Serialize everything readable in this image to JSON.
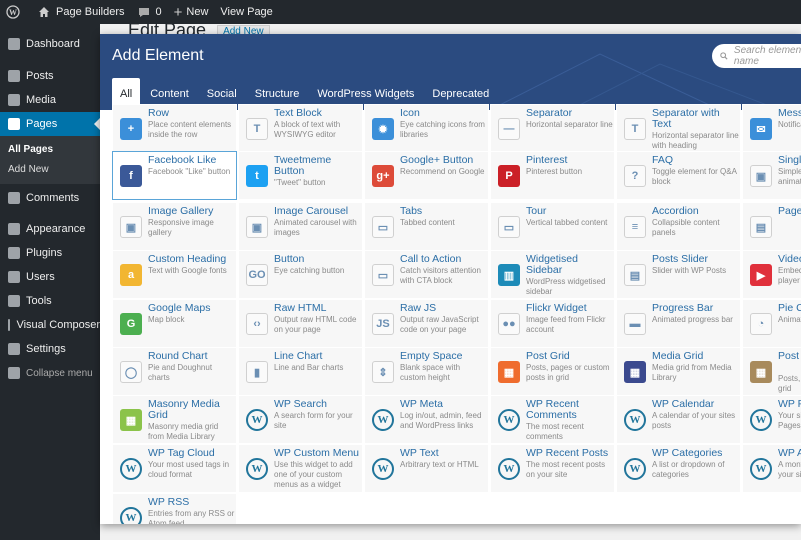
{
  "adminbar": {
    "site": "Page Builders",
    "comments": "0",
    "new": "New",
    "view": "View Page"
  },
  "sidebar": {
    "items": [
      {
        "label": "Dashboard",
        "icon": "dashboard-icon"
      },
      {
        "label": "Posts",
        "icon": "pin-icon"
      },
      {
        "label": "Media",
        "icon": "media-icon"
      },
      {
        "label": "Pages",
        "icon": "pages-icon",
        "active": true
      },
      {
        "label": "Comments",
        "icon": "comment-icon"
      },
      {
        "label": "Appearance",
        "icon": "brush-icon"
      },
      {
        "label": "Plugins",
        "icon": "plugin-icon"
      },
      {
        "label": "Users",
        "icon": "users-icon"
      },
      {
        "label": "Tools",
        "icon": "wrench-icon"
      },
      {
        "label": "Visual Composer",
        "icon": "vc-icon"
      },
      {
        "label": "Settings",
        "icon": "settings-icon"
      },
      {
        "label": "Collapse menu",
        "icon": "collapse-icon"
      }
    ],
    "submenu": [
      "All Pages",
      "Add New"
    ]
  },
  "page": {
    "title": "Edit Page",
    "add_new": "Add New"
  },
  "modal": {
    "title": "Add Element",
    "search_placeholder": "Search element by name",
    "tabs": [
      "All",
      "Content",
      "Social",
      "Structure",
      "WordPress Widgets",
      "Deprecated"
    ]
  },
  "colors": {
    "modal_header": "#2b4b80",
    "admin_dark": "#23282d",
    "active_blue": "#0073aa",
    "title_blue": "#2b6ea6"
  },
  "elements": [
    {
      "title": "Row",
      "desc": "Place content elements inside the row",
      "icon": "row-icon",
      "color": "#3b8fd9"
    },
    {
      "title": "Text Block",
      "desc": "A block of text with WYSIWYG editor",
      "icon": "text-block-icon",
      "color": "#e4e4e4"
    },
    {
      "title": "Icon",
      "desc": "Eye catching icons from libraries",
      "icon": "sun-icon",
      "color": "#3b8fd9"
    },
    {
      "title": "Separator",
      "desc": "Horizontal separator line",
      "icon": "separator-icon",
      "color": "#e4e4e4"
    },
    {
      "title": "Separator with Text",
      "desc": "Horizontal separator line with heading",
      "icon": "separator-text-icon",
      "color": "#e4e4e4"
    },
    {
      "title": "Message Box",
      "desc": "Notification box",
      "icon": "message-icon",
      "color": "#3b8fd9"
    },
    {
      "title": "Facebook Like",
      "desc": "Facebook \"Like\" button",
      "icon": "facebook-icon",
      "color": "#3b5998"
    },
    {
      "title": "Tweetmeme Button",
      "desc": "\"Tweet\" button",
      "icon": "twitter-icon",
      "color": "#1da1f2"
    },
    {
      "title": "Google+ Button",
      "desc": "Recommend on Google",
      "icon": "googleplus-icon",
      "color": "#dd4b39"
    },
    {
      "title": "Pinterest",
      "desc": "Pinterest button",
      "icon": "pinterest-icon",
      "color": "#cb2027"
    },
    {
      "title": "FAQ",
      "desc": "Toggle element for Q&A block",
      "icon": "faq-icon",
      "color": "#e4e4e4"
    },
    {
      "title": "Single Image",
      "desc": "Simple image with CSS animation",
      "icon": "image-icon",
      "color": "#e4e4e4"
    },
    {
      "title": "Image Gallery",
      "desc": "Responsive image gallery",
      "icon": "gallery-icon",
      "color": "#e4e4e4"
    },
    {
      "title": "Image Carousel",
      "desc": "Animated carousel with images",
      "icon": "carousel-icon",
      "color": "#e4e4e4"
    },
    {
      "title": "Tabs",
      "desc": "Tabbed content",
      "icon": "tabs-icon",
      "color": "#e4e4e4"
    },
    {
      "title": "Tour",
      "desc": "Vertical tabbed content",
      "icon": "tour-icon",
      "color": "#e4e4e4"
    },
    {
      "title": "Accordion",
      "desc": "Collapsible content panels",
      "icon": "accordion-icon",
      "color": "#e4e4e4"
    },
    {
      "title": "Page Content",
      "desc": "",
      "icon": "page-content-icon",
      "color": "#e4e4e4"
    },
    {
      "title": "Custom Heading",
      "desc": "Text with Google fonts",
      "icon": "heading-icon",
      "color": "#f2b632"
    },
    {
      "title": "Button",
      "desc": "Eye catching button",
      "icon": "button-icon",
      "color": "#e4e4e4"
    },
    {
      "title": "Call to Action",
      "desc": "Catch visitors attention with CTA block",
      "icon": "cta-icon",
      "color": "#e4e4e4"
    },
    {
      "title": "Widgetised Sidebar",
      "desc": "WordPress widgetised sidebar",
      "icon": "sidebar-icon",
      "color": "#1d8bb8"
    },
    {
      "title": "Posts Slider",
      "desc": "Slider with WP Posts",
      "icon": "slider-icon",
      "color": "#e4e4e4"
    },
    {
      "title": "Video Player",
      "desc": "Embed YouTube/Vimeo player",
      "icon": "video-icon",
      "color": "#e0303b"
    },
    {
      "title": "Google Maps",
      "desc": "Map block",
      "icon": "map-icon",
      "color": "#4caf50"
    },
    {
      "title": "Raw HTML",
      "desc": "Output raw HTML code on your page",
      "icon": "html-icon",
      "color": "#e4e4e4"
    },
    {
      "title": "Raw JS",
      "desc": "Output raw JavaScript code on your page",
      "icon": "js-icon",
      "color": "#e4e4e4"
    },
    {
      "title": "Flickr Widget",
      "desc": "Image feed from Flickr account",
      "icon": "flickr-icon",
      "color": "#e4e4e4"
    },
    {
      "title": "Progress Bar",
      "desc": "Animated progress bar",
      "icon": "progress-icon",
      "color": "#e4e4e4"
    },
    {
      "title": "Pie Chart",
      "desc": "Animated pie chart",
      "icon": "pie-icon",
      "color": "#e4e4e4"
    },
    {
      "title": "Round Chart",
      "desc": "Pie and Doughnut charts",
      "icon": "round-chart-icon",
      "color": "#e4e4e4"
    },
    {
      "title": "Line Chart",
      "desc": "Line and Bar charts",
      "icon": "line-chart-icon",
      "color": "#e4e4e4"
    },
    {
      "title": "Empty Space",
      "desc": "Blank space with custom height",
      "icon": "empty-space-icon",
      "color": "#e4e4e4"
    },
    {
      "title": "Post Grid",
      "desc": "Posts, pages or custom posts in grid",
      "icon": "post-grid-icon",
      "color": "#ef6c2e"
    },
    {
      "title": "Media Grid",
      "desc": "Media grid from Media Library",
      "icon": "media-grid-icon",
      "color": "#3b4a8f"
    },
    {
      "title": "Post Masonry Grid",
      "desc": "Posts, pages in masonry grid",
      "icon": "post-masonry-icon",
      "color": "#a88a5c"
    },
    {
      "title": "Masonry Media Grid",
      "desc": "Masonry media grid from Media Library",
      "icon": "masonry-icon",
      "color": "#8bc34a"
    },
    {
      "title": "WP Search",
      "desc": "A search form for your site",
      "icon": "wordpress-icon",
      "color": "#e4e4e4"
    },
    {
      "title": "WP Meta",
      "desc": "Log in/out, admin, feed and WordPress links",
      "icon": "wordpress-icon",
      "color": "#e4e4e4"
    },
    {
      "title": "WP Recent Comments",
      "desc": "The most recent comments",
      "icon": "wordpress-icon",
      "color": "#e4e4e4"
    },
    {
      "title": "WP Calendar",
      "desc": "A calendar of your sites posts",
      "icon": "wordpress-icon",
      "color": "#e4e4e4"
    },
    {
      "title": "WP Pages",
      "desc": "Your sites WordPress Pages",
      "icon": "wordpress-icon",
      "color": "#e4e4e4"
    },
    {
      "title": "WP Tag Cloud",
      "desc": "Your most used tags in cloud format",
      "icon": "wordpress-icon",
      "color": "#e4e4e4"
    },
    {
      "title": "WP Custom Menu",
      "desc": "Use this widget to add one of your custom menus as a widget",
      "icon": "wordpress-icon",
      "color": "#e4e4e4"
    },
    {
      "title": "WP Text",
      "desc": "Arbitrary text or HTML",
      "icon": "wordpress-icon",
      "color": "#e4e4e4"
    },
    {
      "title": "WP Recent Posts",
      "desc": "The most recent posts on your site",
      "icon": "wordpress-icon",
      "color": "#e4e4e4"
    },
    {
      "title": "WP Categories",
      "desc": "A list or dropdown of categories",
      "icon": "wordpress-icon",
      "color": "#e4e4e4"
    },
    {
      "title": "WP Archives",
      "desc": "A monthly archive of your sites posts",
      "icon": "wordpress-icon",
      "color": "#e4e4e4"
    },
    {
      "title": "WP RSS",
      "desc": "Entries from any RSS or Atom feed",
      "icon": "wordpress-icon",
      "color": "#e4e4e4"
    }
  ]
}
